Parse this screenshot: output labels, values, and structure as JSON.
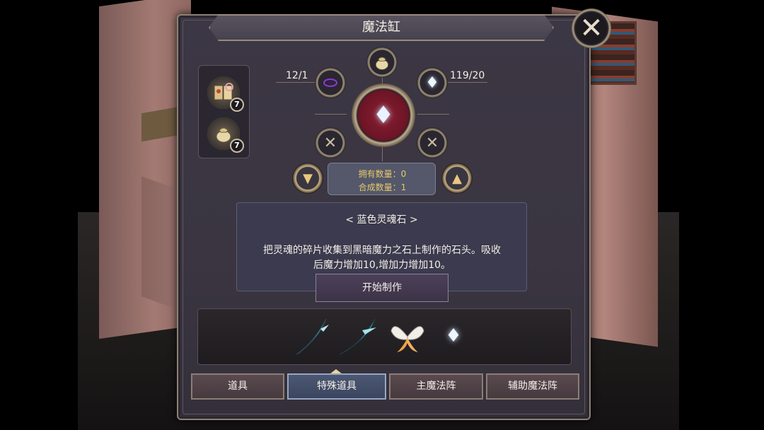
{
  "window": {
    "title": "魔法缸",
    "close_icon": "close-x-icon"
  },
  "inventory": [
    {
      "icon": "magic-book-icon",
      "count": "7"
    },
    {
      "icon": "pouch-icon",
      "count": "7"
    }
  ],
  "crafting": {
    "left_material": {
      "icon": "dark-vortex-icon",
      "ratio": "12/1"
    },
    "right_material": {
      "icon": "white-flame-icon",
      "ratio": "119/20"
    },
    "top_material": {
      "icon": "pouch-icon"
    },
    "result": {
      "icon": "blue-soul-flame-icon"
    },
    "empty_slots": [
      "empty-slot-icon",
      "empty-slot-icon"
    ],
    "owned_label": "拥有数量：0",
    "craft_label": "合成数量：1"
  },
  "description": {
    "title": "< 蓝色灵魂石 >",
    "line1": "把灵魂的碎片收集到黑暗魔力之石上制作的石头。吸收",
    "line2": "后魔力增加10,增加力增加10。"
  },
  "start_button": "开始制作",
  "item_strip": [
    {
      "icon": "blue-feather-blade-icon"
    },
    {
      "icon": "cyan-spear-feather-icon"
    },
    {
      "icon": "white-wing-icon"
    },
    {
      "icon": "white-soul-flame-icon"
    }
  ],
  "tabs": [
    {
      "label": "道具",
      "active": false
    },
    {
      "label": "特殊道具",
      "active": true
    },
    {
      "label": "主魔法阵",
      "active": false
    },
    {
      "label": "辅助魔法阵",
      "active": false
    }
  ],
  "colors": {
    "accent_gold": "#e8c86a",
    "result_red": "#8a1f32",
    "active_tab": "#4c5873"
  }
}
